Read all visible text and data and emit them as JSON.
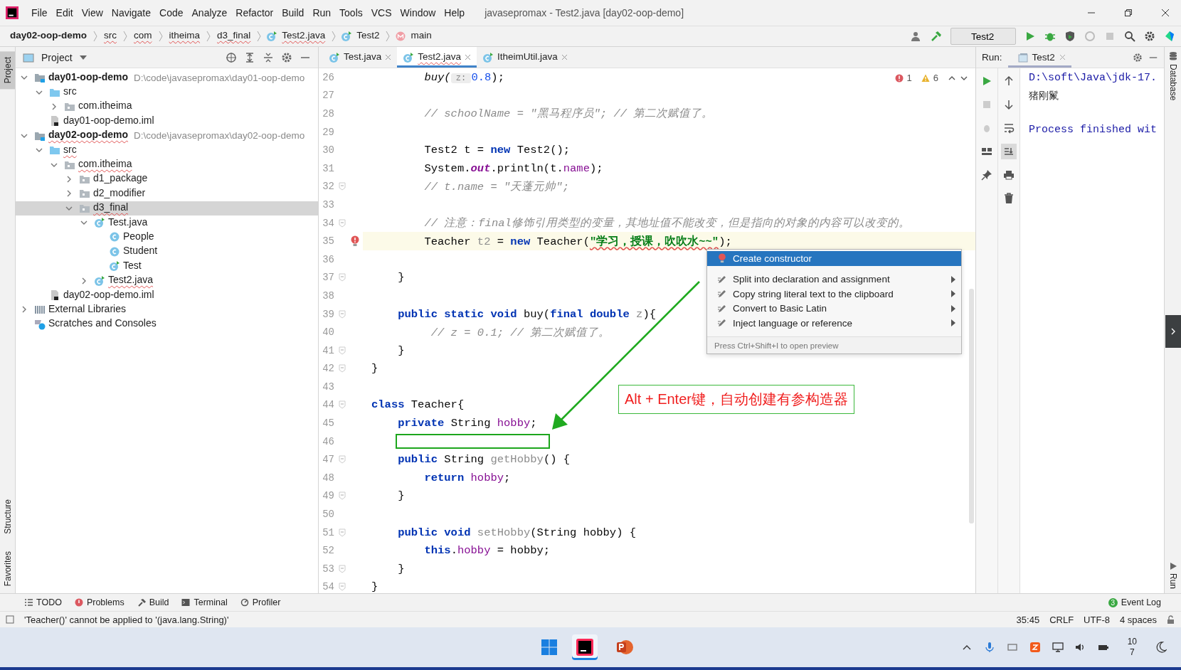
{
  "menu_bar": {
    "items": [
      "File",
      "Edit",
      "View",
      "Navigate",
      "Code",
      "Analyze",
      "Refactor",
      "Build",
      "Run",
      "Tools",
      "VCS",
      "Window",
      "Help"
    ],
    "title": "javasepromax - Test2.java [day02-oop-demo]"
  },
  "breadcrumbs": [
    {
      "label": "day02-oop-demo",
      "kind": "module",
      "bold": true,
      "error": false
    },
    {
      "label": "src",
      "kind": "folder",
      "bold": false,
      "error": true
    },
    {
      "label": "com",
      "kind": "folder",
      "bold": false,
      "error": true
    },
    {
      "label": "itheima",
      "kind": "folder",
      "bold": false,
      "error": true
    },
    {
      "label": "d3_final",
      "kind": "folder",
      "bold": false,
      "error": true
    },
    {
      "label": "Test2.java",
      "kind": "file",
      "bold": false,
      "error": true
    },
    {
      "label": "Test2",
      "kind": "class",
      "bold": false,
      "error": false
    },
    {
      "label": "main",
      "kind": "method",
      "bold": false,
      "error": false
    }
  ],
  "run_config": "Test2",
  "left_stripe": {
    "top": "Project",
    "bottom": [
      "Structure",
      "Favorites"
    ]
  },
  "project_panel": {
    "title": "Project",
    "tree": [
      {
        "label": "day01-oop-demo",
        "path": "D:\\code\\javasepromax\\day01-oop-demo",
        "kind": "module",
        "expanded": true,
        "selected": false,
        "error": false,
        "children": [
          {
            "label": "src",
            "kind": "source",
            "expanded": true,
            "selected": false,
            "error": false,
            "children": [
              {
                "label": "com.itheima",
                "kind": "package",
                "expanded": false,
                "selected": false,
                "error": false
              }
            ]
          },
          {
            "label": "day01-oop-demo.iml",
            "kind": "iml",
            "selected": false,
            "error": false
          }
        ]
      },
      {
        "label": "day02-oop-demo",
        "path": "D:\\code\\javasepromax\\day02-oop-demo",
        "kind": "module",
        "expanded": true,
        "selected": false,
        "error": true,
        "children": [
          {
            "label": "src",
            "kind": "source",
            "expanded": true,
            "selected": false,
            "error": true,
            "children": [
              {
                "label": "com.itheima",
                "kind": "package",
                "expanded": true,
                "selected": false,
                "error": true,
                "children": [
                  {
                    "label": "d1_package",
                    "kind": "package",
                    "expanded": false,
                    "selected": false,
                    "error": false
                  },
                  {
                    "label": "d2_modifier",
                    "kind": "package",
                    "expanded": false,
                    "selected": false,
                    "error": false
                  },
                  {
                    "label": "d3_final",
                    "kind": "package",
                    "expanded": true,
                    "selected": true,
                    "error": true,
                    "children": [
                      {
                        "label": "Test.java",
                        "kind": "class-file",
                        "expanded": true,
                        "selected": false,
                        "error": false,
                        "children": [
                          {
                            "label": "People",
                            "kind": "class",
                            "selected": false,
                            "error": false
                          },
                          {
                            "label": "Student",
                            "kind": "class",
                            "selected": false,
                            "error": false
                          },
                          {
                            "label": "Test",
                            "kind": "class-file",
                            "selected": false,
                            "error": false
                          }
                        ]
                      },
                      {
                        "label": "Test2.java",
                        "kind": "class-file",
                        "expanded": false,
                        "selected": false,
                        "error": true
                      }
                    ]
                  }
                ]
              }
            ]
          },
          {
            "label": "day02-oop-demo.iml",
            "kind": "iml",
            "selected": false,
            "error": false
          }
        ]
      },
      {
        "label": "External Libraries",
        "kind": "libraries",
        "expanded": false,
        "selected": false,
        "error": false
      },
      {
        "label": "Scratches and Consoles",
        "kind": "scratches",
        "selected": false,
        "error": false
      }
    ]
  },
  "editor_tabs": [
    {
      "label": "Test.java",
      "selected": false,
      "error": false
    },
    {
      "label": "Test2.java",
      "selected": true,
      "error": true
    },
    {
      "label": "ItheimUtil.java",
      "selected": false,
      "error": false
    }
  ],
  "inspection": {
    "errors": "1",
    "warnings": "6"
  },
  "code_lines": [
    {
      "n": "26",
      "current": false,
      "fold": false,
      "tokens": [
        {
          "t": "        buy(",
          "kind": "call"
        },
        {
          "t": " z: ",
          "kind": "hint"
        },
        {
          "t": "0.8",
          "kind": "num"
        },
        {
          "t": ");",
          "kind": "pl"
        }
      ]
    },
    {
      "n": "27",
      "current": false,
      "fold": false
    },
    {
      "n": "28",
      "current": false,
      "fold": false,
      "tokens": [
        {
          "t": "        // schoolName = \"黑马程序员\"; // 第二次赋值了。",
          "kind": "cm"
        }
      ]
    },
    {
      "n": "29",
      "current": false,
      "fold": false
    },
    {
      "n": "30",
      "current": false,
      "fold": false,
      "tokens": [
        {
          "t": "        Test2 t = ",
          "kind": "pl"
        },
        {
          "t": "new",
          "kind": "kw"
        },
        {
          "t": " Test2();",
          "kind": "pl"
        }
      ]
    },
    {
      "n": "31",
      "current": false,
      "fold": false,
      "tokens": [
        {
          "t": "        System.",
          "kind": "pl"
        },
        {
          "t": "out",
          "kind": "static"
        },
        {
          "t": ".println(t.",
          "kind": "pl"
        },
        {
          "t": "name",
          "kind": "fd"
        },
        {
          "t": ");",
          "kind": "pl"
        }
      ]
    },
    {
      "n": "32",
      "current": false,
      "fold": true,
      "tokens": [
        {
          "t": "        // t.name = \"天蓬元帅\";",
          "kind": "cm"
        }
      ]
    },
    {
      "n": "33",
      "current": false,
      "fold": false
    },
    {
      "n": "34",
      "current": false,
      "fold": true,
      "tokens": [
        {
          "t": "        // 注意：final修饰引用类型的变量，其地址值不能改变，但是指向的对象的内容可以改变的。",
          "kind": "cm"
        }
      ]
    },
    {
      "n": "35",
      "current": true,
      "fold": false,
      "error": true,
      "tokens": [
        {
          "t": "        Teacher ",
          "kind": "pl"
        },
        {
          "t": "t2",
          "kind": "unused"
        },
        {
          "t": " = ",
          "kind": "pl"
        },
        {
          "t": "new",
          "kind": "kw"
        },
        {
          "t": " Teacher(",
          "kind": "pl"
        },
        {
          "t": "\"学习，授课，吹吹水~~\"",
          "kind": "st",
          "error": true
        },
        {
          "t": ");",
          "kind": "pl"
        }
      ]
    },
    {
      "n": "36",
      "current": false,
      "fold": false
    },
    {
      "n": "37",
      "current": false,
      "fold": true,
      "tokens": [
        {
          "t": "    }",
          "kind": "pl"
        }
      ]
    },
    {
      "n": "38",
      "current": false,
      "fold": false
    },
    {
      "n": "39",
      "current": false,
      "fold": true,
      "tokens": [
        {
          "t": "    public static void ",
          "kind": "kw"
        },
        {
          "t": "buy(",
          "kind": "pl"
        },
        {
          "t": "final double ",
          "kind": "kw"
        },
        {
          "t": "z",
          "kind": "unused"
        },
        {
          "t": "){",
          "kind": "pl"
        }
      ]
    },
    {
      "n": "40",
      "current": false,
      "fold": false,
      "tokens": [
        {
          "t": "         // z = 0.1; // 第二次赋值了。",
          "kind": "cm"
        }
      ]
    },
    {
      "n": "41",
      "current": false,
      "fold": true,
      "tokens": [
        {
          "t": "    }",
          "kind": "pl"
        }
      ]
    },
    {
      "n": "42",
      "current": false,
      "fold": true,
      "tokens": [
        {
          "t": "}",
          "kind": "pl"
        }
      ]
    },
    {
      "n": "43",
      "current": false,
      "fold": false
    },
    {
      "n": "44",
      "current": false,
      "fold": true,
      "tokens": [
        {
          "t": "class ",
          "kind": "kw"
        },
        {
          "t": "Teacher{",
          "kind": "pl"
        }
      ]
    },
    {
      "n": "45",
      "current": false,
      "fold": false,
      "tokens": [
        {
          "t": "    private ",
          "kind": "kw"
        },
        {
          "t": "String ",
          "kind": "pl"
        },
        {
          "t": "hobby",
          "kind": "fd"
        },
        {
          "t": ";",
          "kind": "pl"
        }
      ]
    },
    {
      "n": "46",
      "current": false,
      "fold": false
    },
    {
      "n": "47",
      "current": false,
      "fold": true,
      "tokens": [
        {
          "t": "    public ",
          "kind": "kw"
        },
        {
          "t": "String ",
          "kind": "pl"
        },
        {
          "t": "getHobby",
          "kind": "unused"
        },
        {
          "t": "() {",
          "kind": "pl"
        }
      ]
    },
    {
      "n": "48",
      "current": false,
      "fold": false,
      "tokens": [
        {
          "t": "        return ",
          "kind": "kw"
        },
        {
          "t": "hobby",
          "kind": "fd"
        },
        {
          "t": ";",
          "kind": "pl"
        }
      ]
    },
    {
      "n": "49",
      "current": false,
      "fold": true,
      "tokens": [
        {
          "t": "    }",
          "kind": "pl"
        }
      ]
    },
    {
      "n": "50",
      "current": false,
      "fold": false
    },
    {
      "n": "51",
      "current": false,
      "fold": true,
      "tokens": [
        {
          "t": "    public void ",
          "kind": "kw"
        },
        {
          "t": "setHobby",
          "kind": "unused"
        },
        {
          "t": "(String hobby) {",
          "kind": "pl"
        }
      ]
    },
    {
      "n": "52",
      "current": false,
      "fold": false,
      "tokens": [
        {
          "t": "        this",
          "kind": "kw"
        },
        {
          "t": ".",
          "kind": "pl"
        },
        {
          "t": "hobby",
          "kind": "fd"
        },
        {
          "t": " = hobby;",
          "kind": "pl"
        }
      ]
    },
    {
      "n": "53",
      "current": false,
      "fold": true,
      "tokens": [
        {
          "t": "    }",
          "kind": "pl"
        }
      ]
    },
    {
      "n": "54",
      "current": false,
      "fold": true,
      "tokens": [
        {
          "t": "}",
          "kind": "pl"
        }
      ]
    }
  ],
  "context_menu": {
    "items": [
      {
        "label": "Create constructor",
        "kind": "fix",
        "selected": true,
        "submenu": false
      },
      {
        "label": "Split into declaration and assignment",
        "kind": "intention",
        "selected": false,
        "submenu": true
      },
      {
        "label": "Copy string literal text to the clipboard",
        "kind": "intention",
        "selected": false,
        "submenu": true
      },
      {
        "label": "Convert to Basic Latin",
        "kind": "intention",
        "selected": false,
        "submenu": true
      },
      {
        "label": "Inject language or reference",
        "kind": "intention",
        "selected": false,
        "submenu": true
      }
    ],
    "hint": "Press Ctrl+Shift+I to open preview"
  },
  "callout": "Alt + Enter键，自动创建有参构造器",
  "run_panel": {
    "label": "Run:",
    "tab": "Test2",
    "output": [
      {
        "text": "D:\\soft\\Java\\jdk-17.",
        "kind": "system"
      },
      {
        "text": "猪刚鬣",
        "kind": "stdout"
      },
      {
        "text": "Process finished wit",
        "kind": "exit"
      }
    ]
  },
  "right_stripe": {
    "top": "Database",
    "bottom": "Run"
  },
  "bottom_tools": [
    "TODO",
    "Problems",
    "Build",
    "Terminal",
    "Profiler"
  ],
  "event_log": {
    "label": "Event Log",
    "count": "3"
  },
  "status": {
    "message": "'Teacher()' cannot be applied to '(java.lang.String)'",
    "position": "35:45",
    "line_sep": "CRLF",
    "encoding": "UTF-8",
    "indent": "4 spaces"
  },
  "taskbar": {
    "clock": [
      "10",
      "7"
    ]
  }
}
